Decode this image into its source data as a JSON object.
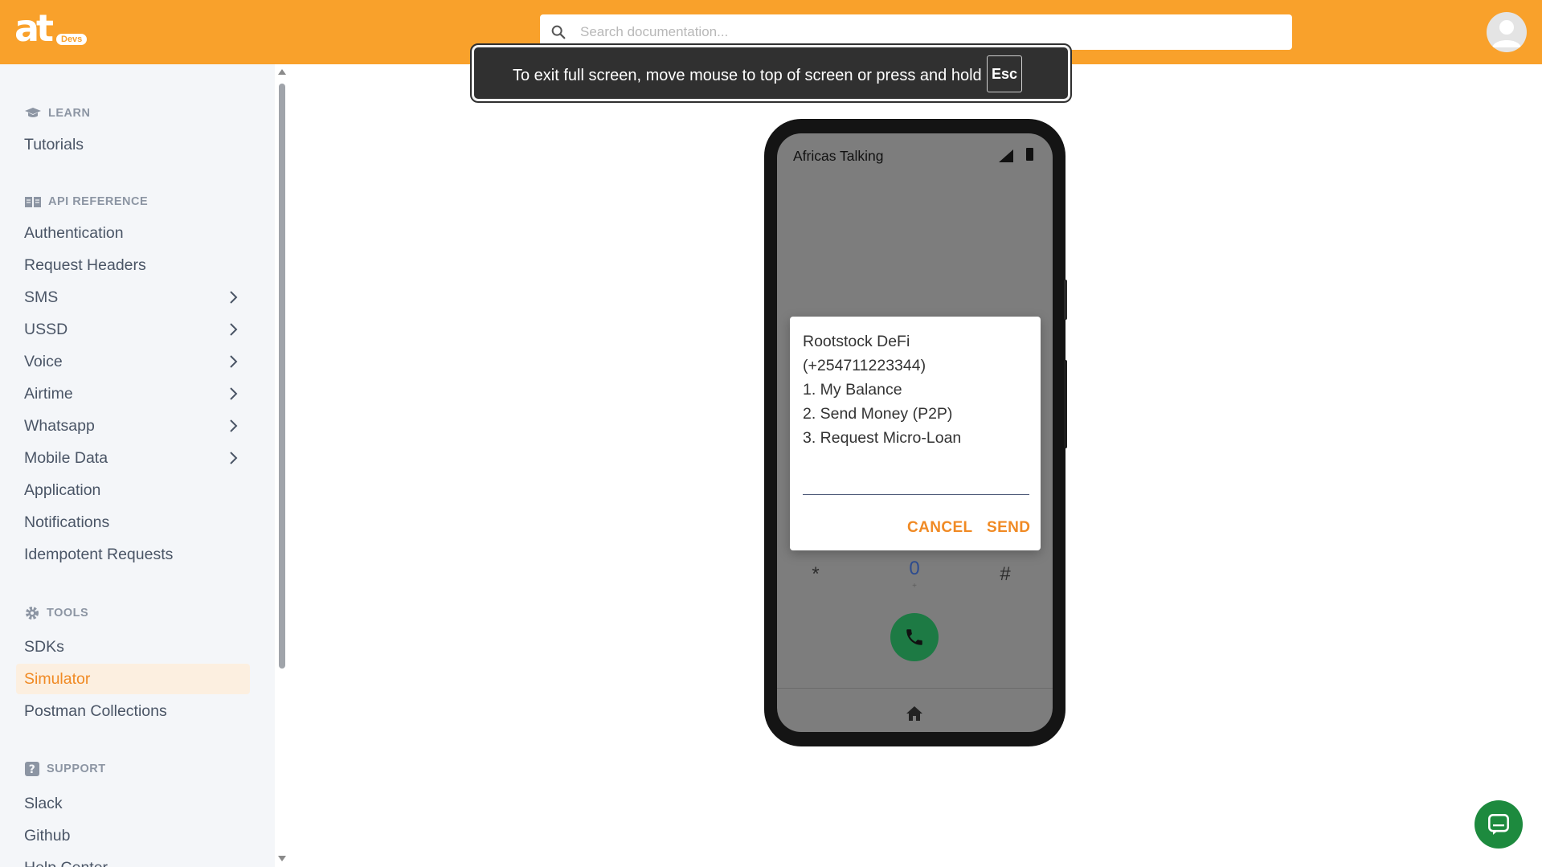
{
  "header": {
    "logo_text": "at",
    "logo_badge": "Devs",
    "search_placeholder": "Search documentation..."
  },
  "fullscreen_notice": {
    "text": "To exit full screen, move mouse to top of screen or press and hold",
    "key": "Esc"
  },
  "sidebar": {
    "learn": {
      "heading": "LEARN",
      "items": [
        "Tutorials"
      ]
    },
    "api_reference": {
      "heading": "API REFERENCE",
      "items": [
        {
          "label": "Authentication",
          "expandable": false
        },
        {
          "label": "Request Headers",
          "expandable": false
        },
        {
          "label": "SMS",
          "expandable": true
        },
        {
          "label": "USSD",
          "expandable": true
        },
        {
          "label": "Voice",
          "expandable": true
        },
        {
          "label": "Airtime",
          "expandable": true
        },
        {
          "label": "Whatsapp",
          "expandable": true
        },
        {
          "label": "Mobile Data",
          "expandable": true
        },
        {
          "label": "Application",
          "expandable": false
        },
        {
          "label": "Notifications",
          "expandable": false
        },
        {
          "label": "Idempotent Requests",
          "expandable": false
        }
      ]
    },
    "tools": {
      "heading": "TOOLS",
      "items": [
        "SDKs",
        "Simulator",
        "Postman Collections"
      ],
      "active": "Simulator"
    },
    "support": {
      "heading": "SUPPORT",
      "items": [
        "Slack",
        "Github",
        "Help Center"
      ]
    }
  },
  "phone": {
    "status_title": "Africas Talking",
    "dialpad": {
      "row_keys": [
        "*",
        "0",
        "#"
      ],
      "zero_sub": "+"
    }
  },
  "ussd_dialog": {
    "lines": [
      "Rootstock DeFi",
      "(+254711223344)",
      "1. My Balance",
      "2. Send Money (P2P)",
      "3. Request Micro-Loan"
    ],
    "input_value": "",
    "cancel_label": "CANCEL",
    "send_label": "SEND"
  },
  "colors": {
    "brand_orange": "#f9a12b",
    "accent_orange": "#f08a24",
    "call_green": "#1d7a44"
  }
}
